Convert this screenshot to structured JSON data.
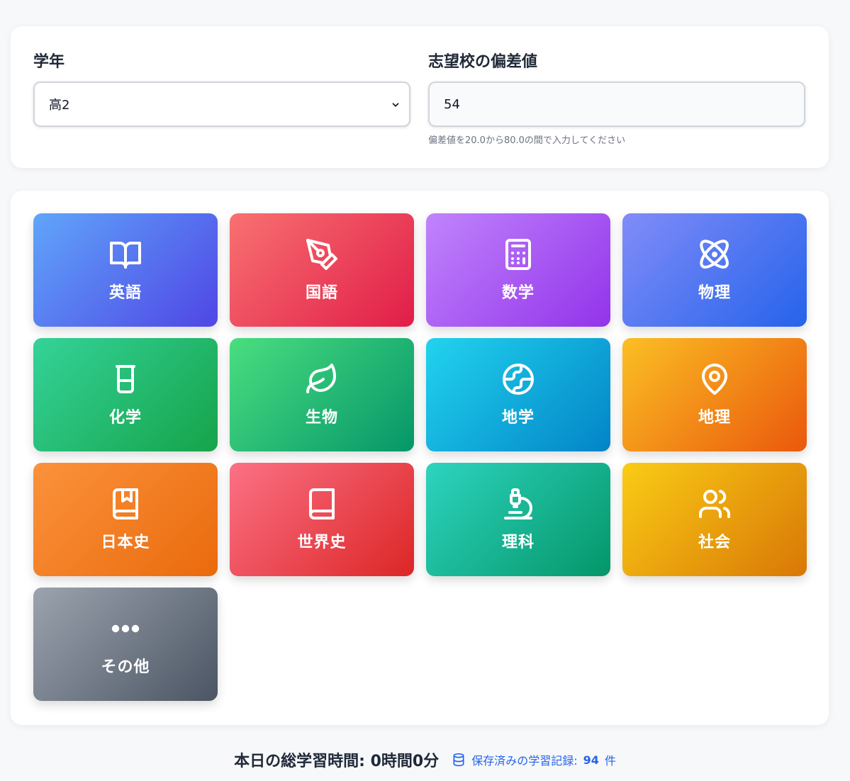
{
  "settings": {
    "grade_label": "学年",
    "grade_value": "高2",
    "target_label": "志望校の偏差値",
    "target_value": "54",
    "target_hint": "偏差値を20.0から80.0の間で入力してください"
  },
  "subjects": [
    {
      "label": "英語",
      "icon": "book-open-icon",
      "colors": [
        "#60a5fa",
        "#4f46e5"
      ]
    },
    {
      "label": "国語",
      "icon": "pen-nib-icon",
      "colors": [
        "#f87171",
        "#e11d48"
      ]
    },
    {
      "label": "数学",
      "icon": "calculator-icon",
      "colors": [
        "#c084fc",
        "#9333ea"
      ]
    },
    {
      "label": "物理",
      "icon": "atom-icon",
      "colors": [
        "#818cf8",
        "#2563eb"
      ]
    },
    {
      "label": "化学",
      "icon": "beaker-icon",
      "colors": [
        "#34d399",
        "#16a34a"
      ]
    },
    {
      "label": "生物",
      "icon": "leaf-icon",
      "colors": [
        "#4ade80",
        "#059669"
      ]
    },
    {
      "label": "地学",
      "icon": "globe-icon",
      "colors": [
        "#22d3ee",
        "#0284c7"
      ]
    },
    {
      "label": "地理",
      "icon": "map-pin-icon",
      "colors": [
        "#fbbf24",
        "#ea580c"
      ]
    },
    {
      "label": "日本史",
      "icon": "bookmark-book-icon",
      "colors": [
        "#fb923c",
        "#ea6a0c"
      ]
    },
    {
      "label": "世界史",
      "icon": "book-icon",
      "colors": [
        "#fb7185",
        "#dc2626"
      ]
    },
    {
      "label": "理科",
      "icon": "microscope-icon",
      "colors": [
        "#2dd4bf",
        "#059669"
      ]
    },
    {
      "label": "社会",
      "icon": "users-icon",
      "colors": [
        "#facc15",
        "#d97706"
      ]
    },
    {
      "label": "その他",
      "icon": "more-dots-icon",
      "colors": [
        "#9ca3af",
        "#4b5563"
      ]
    }
  ],
  "footer": {
    "total_text": "本日の総学習時間: 0時間0分",
    "saved_prefix": "保存済みの学習記録:",
    "saved_count": "94",
    "saved_unit": "件"
  }
}
